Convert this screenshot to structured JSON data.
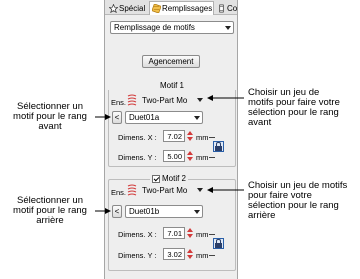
{
  "tabs": [
    {
      "label": "Spécial",
      "icon": "star-icon"
    },
    {
      "label": "Remplissages",
      "icon": "fill-icon"
    },
    {
      "label": "Cor",
      "icon": "thread-icon"
    }
  ],
  "fill_type": {
    "value": "Remplissage de motifs"
  },
  "agencement_label": "Agencement",
  "motif1": {
    "title": "Motif 1",
    "ens_label": "Ens.",
    "set_value": "Two-Part Mo",
    "motif_value": "Duet01a",
    "nav_label": "<",
    "dim_x_label": "Dimens. X :",
    "dim_x_value": "7.02",
    "dim_y_label": "Dimens. Y :",
    "dim_y_value": "5.00",
    "unit": "mm"
  },
  "motif2": {
    "title": "Motif 2",
    "checked": true,
    "ens_label": "Ens.",
    "set_value": "Two-Part Mo",
    "motif_value": "Duet01b",
    "nav_label": "<",
    "dim_x_label": "Dimens. X :",
    "dim_x_value": "7.01",
    "dim_y_label": "Dimens. Y :",
    "dim_y_value": "3.02",
    "unit": "mm"
  },
  "callouts": {
    "right_top": [
      "Choisir un jeu de",
      "motifs pour faire votre",
      "sélection pour le rang",
      "avant"
    ],
    "left_top": [
      "Sélectionner un",
      "motif pour le rang",
      "avant"
    ],
    "right_bottom": [
      "Choisir un jeu de motifs",
      "pour faire votre",
      "sélection pour le rang",
      "arrière"
    ],
    "left_bottom": [
      "Sélectionner un",
      "motif pour le rang",
      "arrière"
    ]
  },
  "colors": {
    "accent": "#d23a3a",
    "panel_bg": "#eeeeee"
  }
}
